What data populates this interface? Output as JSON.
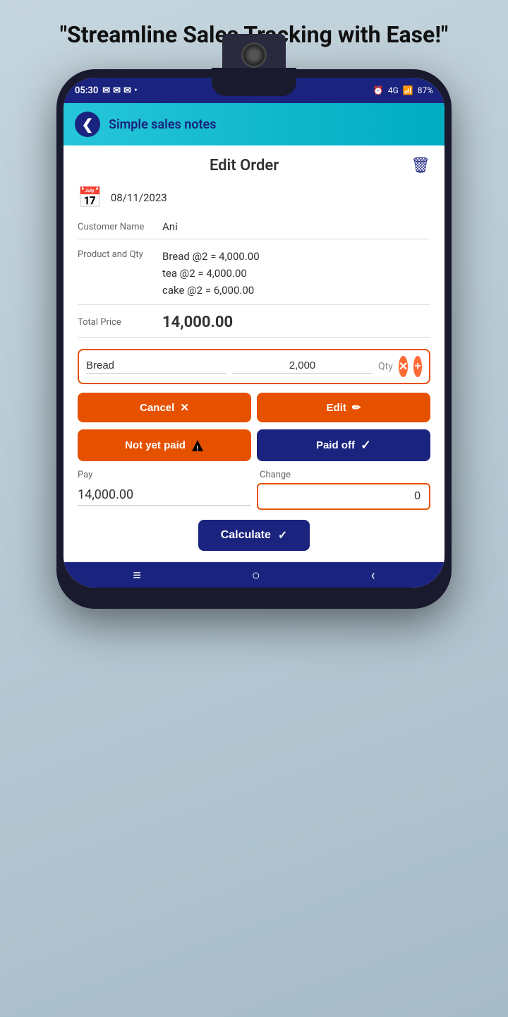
{
  "tagline": "\"Streamline Sales Tracking with Ease!\"",
  "statusBar": {
    "time": "05:30",
    "battery": "87%",
    "network": "4G"
  },
  "header": {
    "appName": "Simple sales notes",
    "backIcon": "‹"
  },
  "editOrder": {
    "title": "Edit Order",
    "date": "08/11/2023",
    "customerNameLabel": "Customer Name",
    "customerName": "Ani",
    "productLabel": "Product and Qty",
    "products": [
      "Bread @2 = 4,000.00",
      "tea @2 = 4,000.00",
      "cake @2 = 6,000.00"
    ],
    "totalPriceLabel": "Total Price",
    "totalPrice": "14,000.00"
  },
  "productInput": {
    "productPlaceholder": "Bread",
    "priceValue": "2,000",
    "qtyLabel": "Qty"
  },
  "buttons": {
    "cancel": "Cancel",
    "edit": "Edit",
    "notYetPaid": "Not yet paid",
    "paidOff": "Paid off",
    "calculate": "Calculate"
  },
  "payment": {
    "payLabel": "Pay",
    "changeLabel": "Change",
    "payValue": "14,000.00",
    "changeValue": "0"
  },
  "bottomNav": {
    "menu": "≡",
    "home": "○",
    "back": "‹"
  }
}
